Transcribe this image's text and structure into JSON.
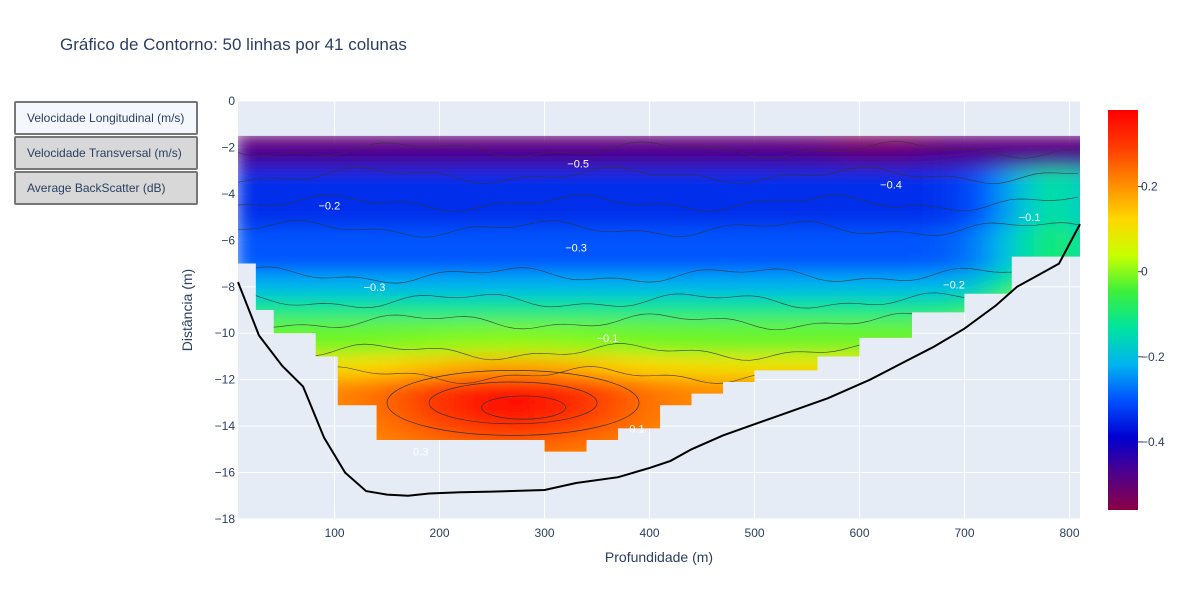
{
  "title": "Gráfico de Contorno: 50 linhas por 41 colunas",
  "buttons": [
    {
      "label": "Velocidade Longitudinal (m/s)",
      "active": true
    },
    {
      "label": "Velocidade Transversal (m/s)",
      "active": false
    },
    {
      "label": "Average BackScatter (dB)",
      "active": false
    }
  ],
  "chart_data": {
    "type": "heatmap",
    "subtype": "contour",
    "xlabel": "Profundidade (m)",
    "ylabel": "Distância (m)",
    "xlim": [
      8,
      810
    ],
    "ylim": [
      -18,
      0
    ],
    "xticks": [
      100,
      200,
      300,
      400,
      500,
      600,
      700,
      800
    ],
    "yticks": [
      0,
      -2,
      -4,
      -6,
      -8,
      -10,
      -12,
      -14,
      -16,
      -18
    ],
    "colorbar": {
      "range": [
        -0.56,
        0.38
      ],
      "ticks": [
        0.2,
        0,
        -0.2,
        -0.4
      ],
      "colorscale": [
        "#8b0045",
        "#50008c",
        "#0000d0",
        "#0050ff",
        "#00b4f0",
        "#00e3a0",
        "#3cf03c",
        "#c8ff00",
        "#ffd700",
        "#ff8a00",
        "#ff3a00",
        "#ff0000"
      ]
    },
    "contour_labels": [
      {
        "text": "−0.5",
        "x": 332,
        "y": -2.7
      },
      {
        "text": "−0.4",
        "x": 630,
        "y": -3.6
      },
      {
        "text": "−0.2",
        "x": 95,
        "y": -4.5
      },
      {
        "text": "−0.1",
        "x": 762,
        "y": -5.0
      },
      {
        "text": "−0.3",
        "x": 330,
        "y": -6.3
      },
      {
        "text": "−0.3",
        "x": 138,
        "y": -8.0
      },
      {
        "text": "−0.2",
        "x": 690,
        "y": -7.9
      },
      {
        "text": "−0.1",
        "x": 360,
        "y": -10.2
      },
      {
        "text": "0.1",
        "x": 388,
        "y": -14.1
      },
      {
        "text": "0.3",
        "x": 182,
        "y": -15.1
      }
    ],
    "bottom_profile": {
      "x": [
        8,
        28,
        50,
        70,
        90,
        110,
        130,
        150,
        170,
        190,
        220,
        250,
        300,
        330,
        370,
        400,
        420,
        440,
        470,
        520,
        570,
        610,
        640,
        670,
        700,
        730,
        750,
        770,
        790,
        810
      ],
      "y": [
        -7.8,
        -10.1,
        -11.4,
        -12.3,
        -14.5,
        -16.0,
        -16.8,
        -16.95,
        -17.0,
        -16.9,
        -16.85,
        -16.82,
        -16.75,
        -16.45,
        -16.2,
        -15.8,
        -15.5,
        -15.0,
        -14.4,
        -13.6,
        -12.8,
        -12.0,
        -11.3,
        -10.6,
        -9.8,
        -8.8,
        -8.0,
        -7.5,
        -7.0,
        -5.3
      ]
    },
    "data_region": {
      "top_y": -1.5,
      "x": [
        8,
        8,
        25,
        25,
        42,
        42,
        82,
        82,
        103,
        103,
        140,
        140,
        300,
        300,
        340,
        340,
        370,
        370,
        410,
        410,
        440,
        440,
        470,
        470,
        500,
        500,
        560,
        560,
        600,
        600,
        650,
        650,
        700,
        700,
        745,
        745,
        810,
        810
      ],
      "y": [
        -1.5,
        -7.0,
        -7.0,
        -9.0,
        -9.0,
        -10.0,
        -10.0,
        -11.0,
        -11.0,
        -13.1,
        -13.1,
        -14.6,
        -14.6,
        -15.1,
        -15.1,
        -14.6,
        -14.6,
        -14.1,
        -14.1,
        -13.1,
        -13.1,
        -12.6,
        -12.6,
        -12.1,
        -12.1,
        -11.6,
        -11.6,
        -11.0,
        -11.0,
        -10.2,
        -10.2,
        -9.1,
        -9.1,
        -8.3,
        -8.3,
        -6.7,
        -6.7,
        -1.5
      ]
    }
  }
}
